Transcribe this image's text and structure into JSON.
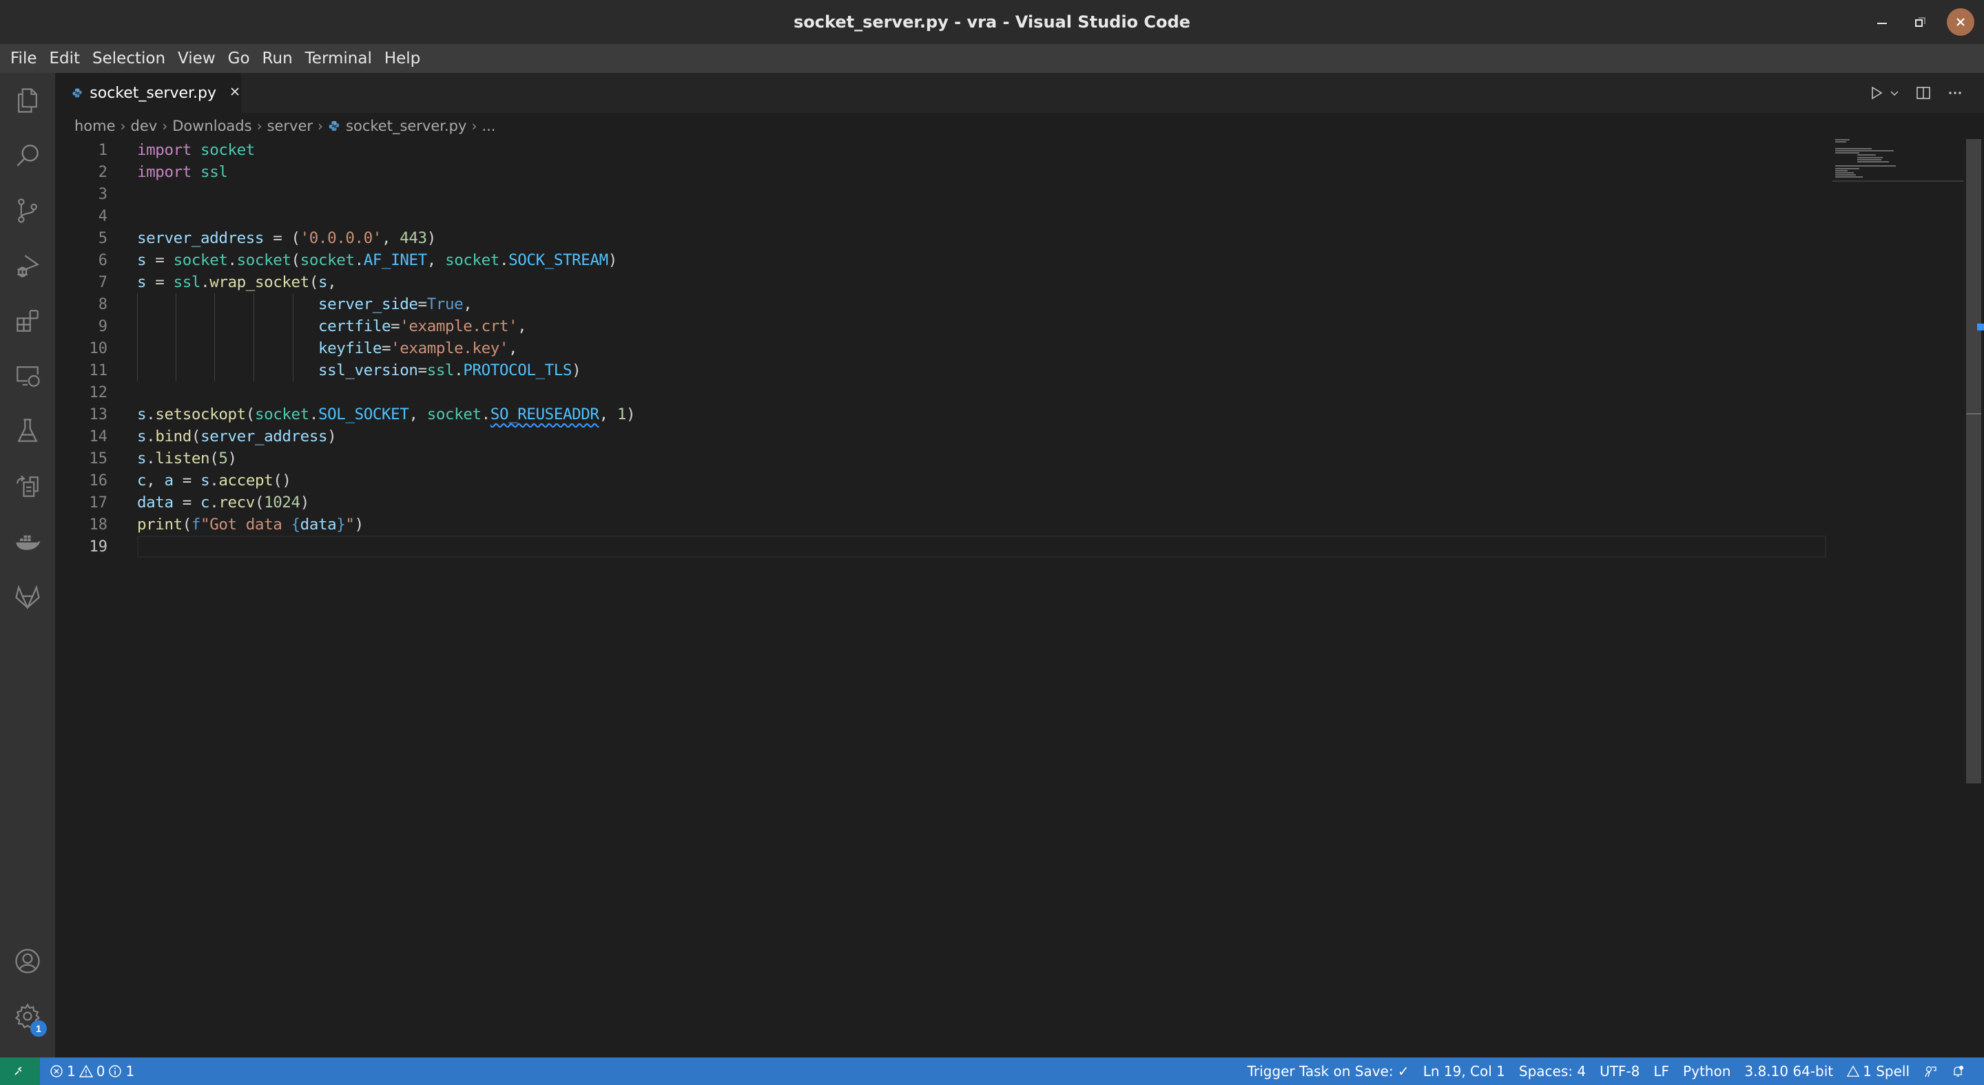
{
  "window": {
    "title": "socket_server.py - vra - Visual Studio Code",
    "close_color": "#a96e4c"
  },
  "menu": {
    "items": [
      "File",
      "Edit",
      "Selection",
      "View",
      "Go",
      "Run",
      "Terminal",
      "Help"
    ]
  },
  "activity_bar": {
    "items": [
      {
        "icon": "explorer-icon"
      },
      {
        "icon": "search-icon"
      },
      {
        "icon": "source-control-icon"
      },
      {
        "icon": "run-debug-icon"
      },
      {
        "icon": "extensions-icon"
      },
      {
        "icon": "remote-explorer-icon"
      },
      {
        "icon": "testing-icon"
      },
      {
        "icon": "remote-repositories-icon"
      },
      {
        "icon": "docker-icon"
      },
      {
        "icon": "gitlab-icon"
      }
    ],
    "bottom": [
      {
        "icon": "accounts-icon"
      },
      {
        "icon": "settings-gear-icon",
        "badge": "1"
      }
    ]
  },
  "tabs": [
    {
      "label": "socket_server.py",
      "icon": "python-file-icon",
      "active": true
    }
  ],
  "editor_actions": [
    "run-icon",
    "chevron-down-icon",
    "split-editor-icon",
    "more-actions-icon"
  ],
  "breadcrumb": {
    "items": [
      "home",
      "dev",
      "Downloads",
      "server",
      "socket_server.py",
      "..."
    ]
  },
  "editor": {
    "language": "python",
    "current_line": 19,
    "lines": [
      "import socket",
      "import ssl",
      "",
      "",
      "server_address = ('0.0.0.0', 443)",
      "s = socket.socket(socket.AF_INET, socket.SOCK_STREAM)",
      "s = ssl.wrap_socket(s,",
      "                    server_side=True,",
      "                    certfile='example.crt',",
      "                    keyfile='example.key',",
      "                    ssl_version=ssl.PROTOCOL_TLS)",
      "",
      "s.setsockopt(socket.SOL_SOCKET, socket.SO_REUSEADDR, 1)",
      "s.bind(server_address)",
      "s.listen(5)",
      "c, a = s.accept()",
      "data = c.recv(1024)",
      "print(f\"Got data {data}\")",
      ""
    ],
    "diagnostic": {
      "line": 13,
      "text": "SO_REUSEADDR"
    }
  },
  "status_bar": {
    "remote_icon": "remote-indicator-icon",
    "errors": "1",
    "warnings": "0",
    "infos": "1",
    "trigger_task": "Trigger Task on Save: ✓",
    "position": "Ln 19, Col 1",
    "indentation": "Spaces: 4",
    "encoding": "UTF-8",
    "eol": "LF",
    "language": "Python",
    "interpreter": "3.8.10 64-bit",
    "spell": "1 Spell",
    "background_color": "#3077c8",
    "remote_color": "#16825d"
  }
}
